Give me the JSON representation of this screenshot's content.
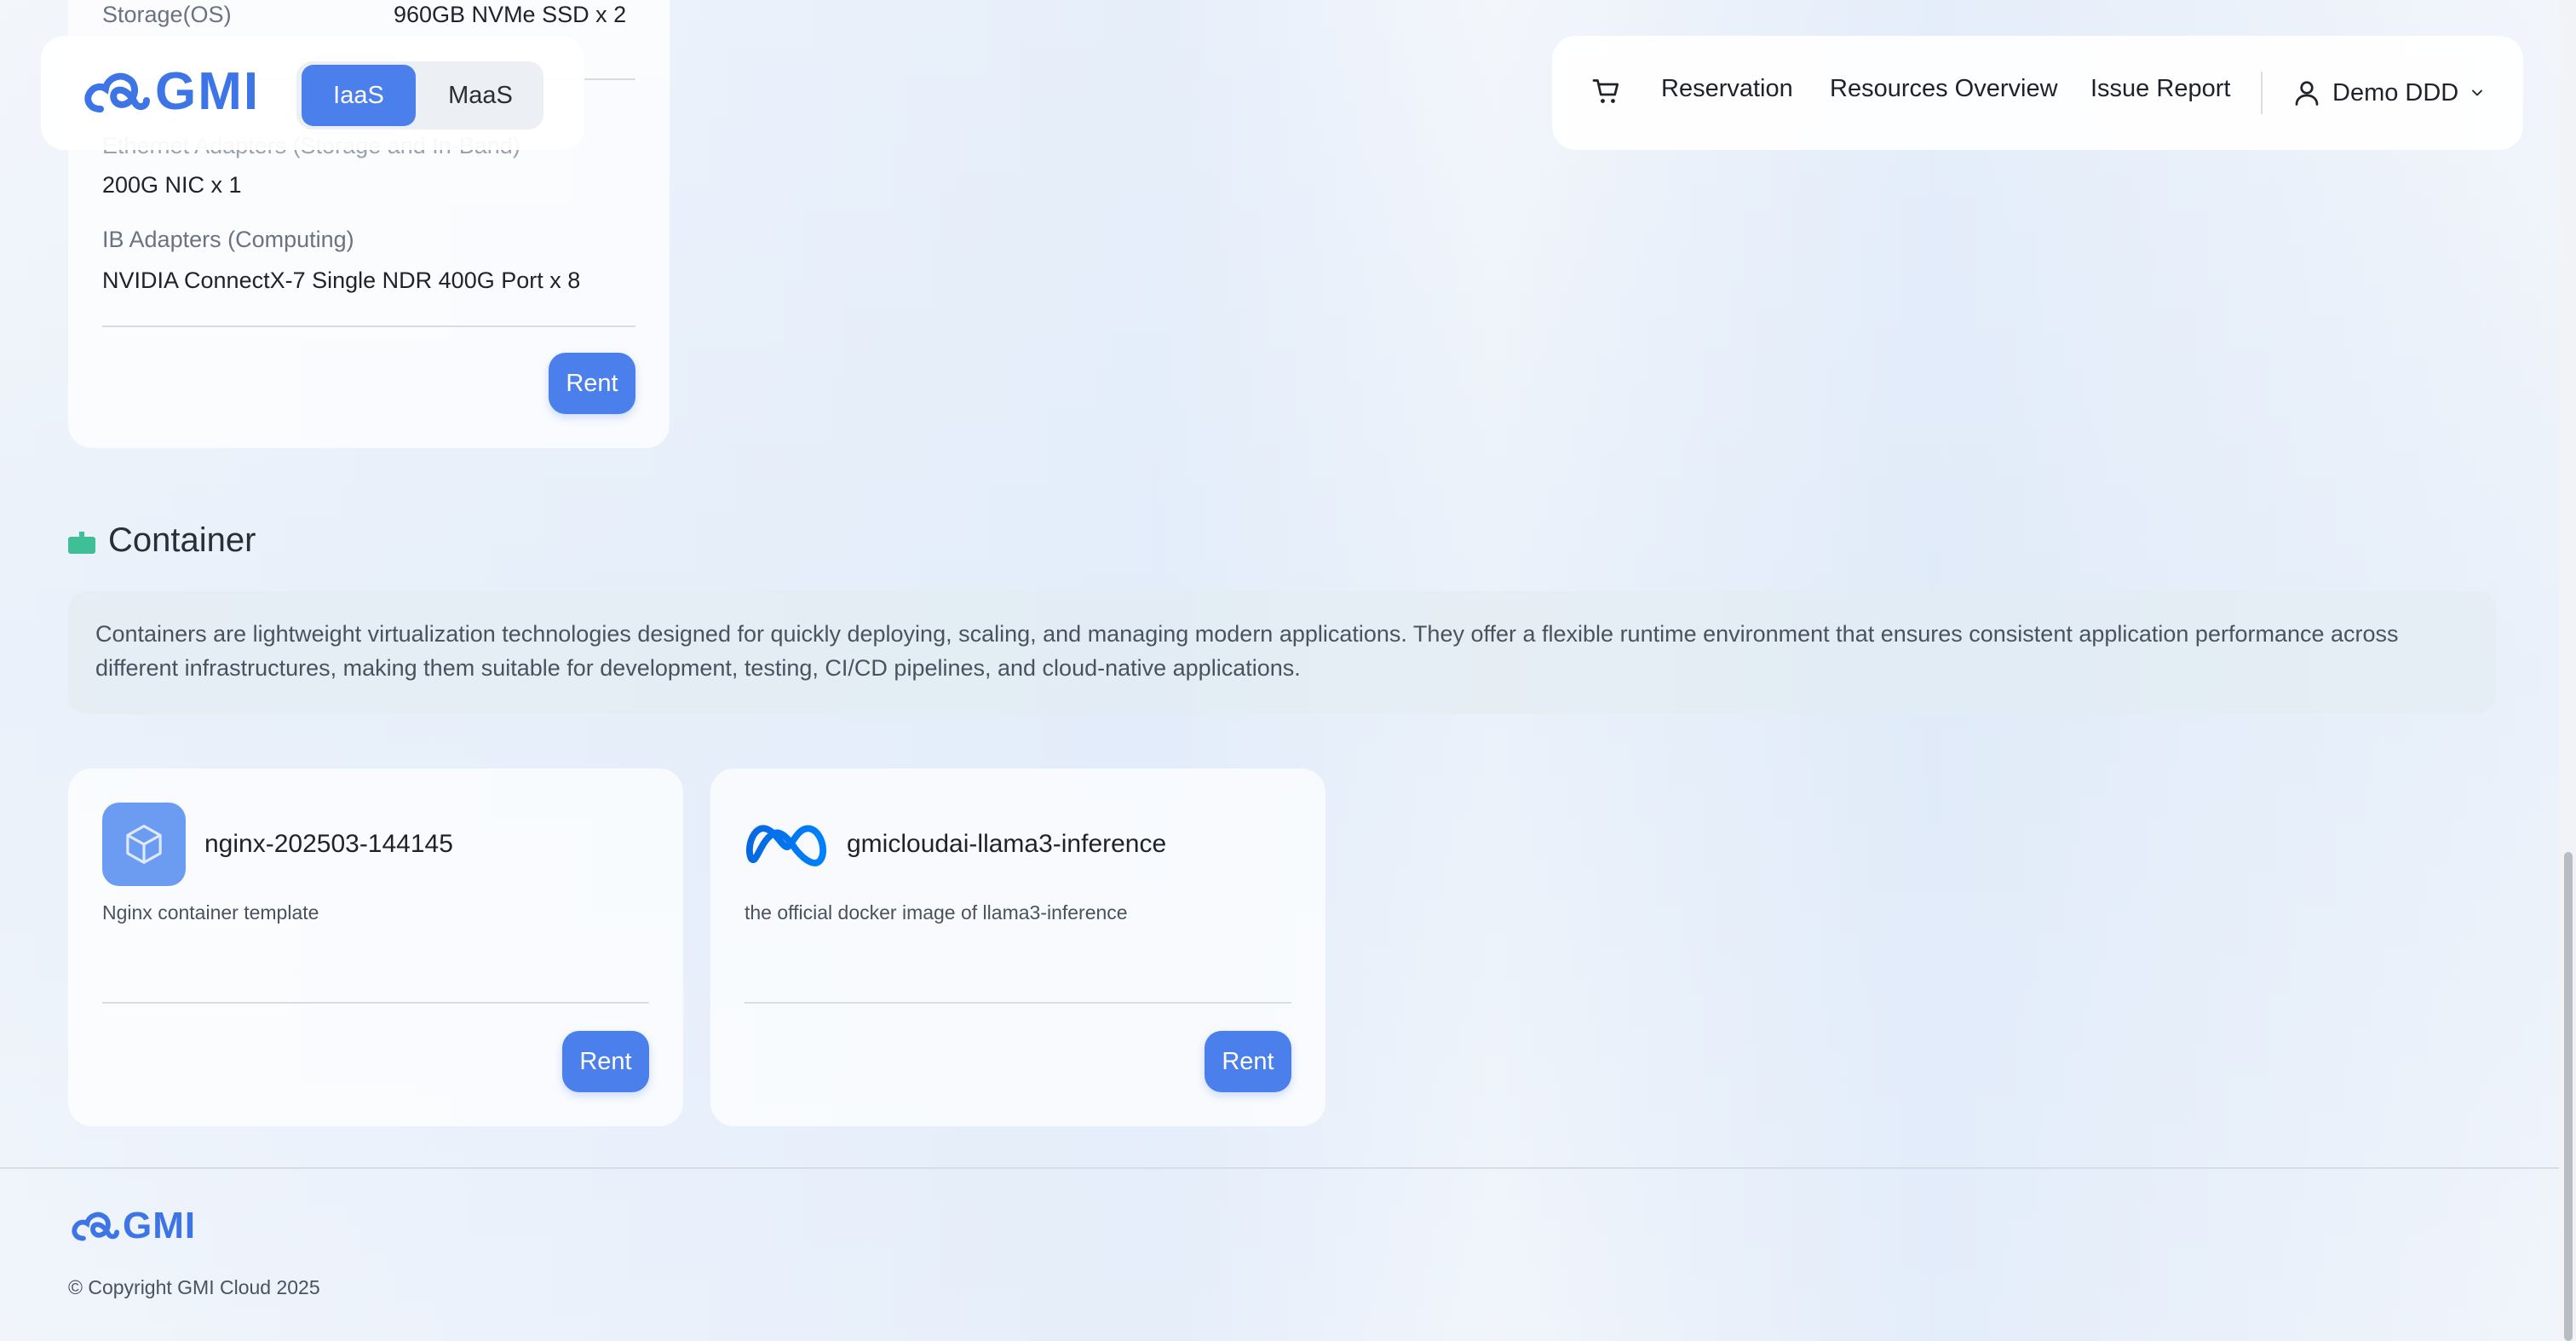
{
  "header": {
    "logo_text": "GMI",
    "segments": {
      "iaas": "IaaS",
      "maas": "MaaS",
      "active": "IaaS"
    },
    "nav": {
      "reservation": "Reservation",
      "resources_overview": "Resources Overview",
      "issue_report": "Issue Report",
      "user": "Demo DDD"
    }
  },
  "spec_card": {
    "storage_label": "Storage(OS)",
    "storage_value": "960GB NVMe SSD x 2",
    "ethernet_label": "Ethernet Adapters (Storage and In-Band)",
    "ethernet_value": "200G NIC x 1",
    "ib_label": "IB Adapters (Computing)",
    "ib_value": "NVIDIA ConnectX-7 Single NDR 400G Port x 8",
    "rent_label": "Rent"
  },
  "container_section": {
    "title": "Container",
    "description": "Containers are lightweight virtualization technologies designed for quickly deploying, scaling, and managing modern applications. They offer a flexible runtime environment that ensures consistent application performance across different infrastructures, making them suitable for development, testing, CI/CD pipelines, and cloud-native applications.",
    "cards": [
      {
        "name": "nginx-202503-144145",
        "description": "Nginx container template",
        "icon": "cube-icon",
        "rent_label": "Rent"
      },
      {
        "name": "gmicloudai-llama3-inference",
        "description": "the official docker image of llama3-inference",
        "icon": "meta-logo-icon",
        "rent_label": "Rent"
      }
    ]
  },
  "footer": {
    "logo_text": "GMI",
    "copyright": "© Copyright GMI Cloud 2025"
  },
  "colors": {
    "accent": "#4a7fec",
    "brand": "#3d74e6",
    "section_icon": "#3fbf95"
  }
}
